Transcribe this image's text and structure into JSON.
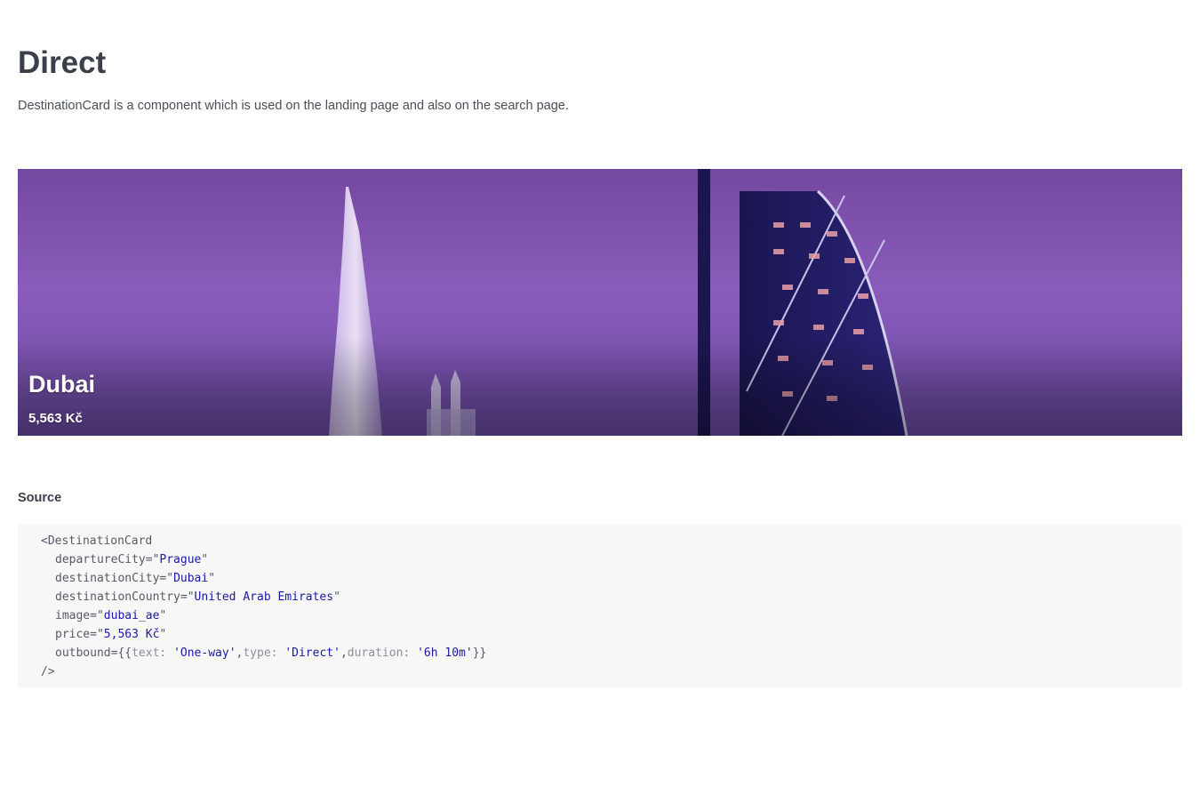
{
  "page": {
    "title": "Direct",
    "description": "DestinationCard is a component which is used on the landing page and also on the search page."
  },
  "card": {
    "city": "Dubai",
    "price": "5,563 Kč"
  },
  "source": {
    "label": "Source",
    "code": {
      "open_tag": "<DestinationCard",
      "attrs": [
        {
          "name": "departureCity",
          "value": "Prague"
        },
        {
          "name": "destinationCity",
          "value": "Dubai"
        },
        {
          "name": "destinationCountry",
          "value": "United Arab Emirates"
        },
        {
          "name": "image",
          "value": "dubai_ae"
        },
        {
          "name": "price",
          "value": "5,563 Kč"
        }
      ],
      "outbound": {
        "name": "outbound",
        "text_key": "text:",
        "text_value": "'One-way'",
        "type_key": "type:",
        "type_value": "'Direct'",
        "duration_key": "duration:",
        "duration_value": "'6h 10m'"
      },
      "close_tag": "/>"
    }
  },
  "colors": {
    "card_sky": "#7a4fb4",
    "code_string": "#1a1aa6",
    "code_background": "#f7f7f8"
  }
}
